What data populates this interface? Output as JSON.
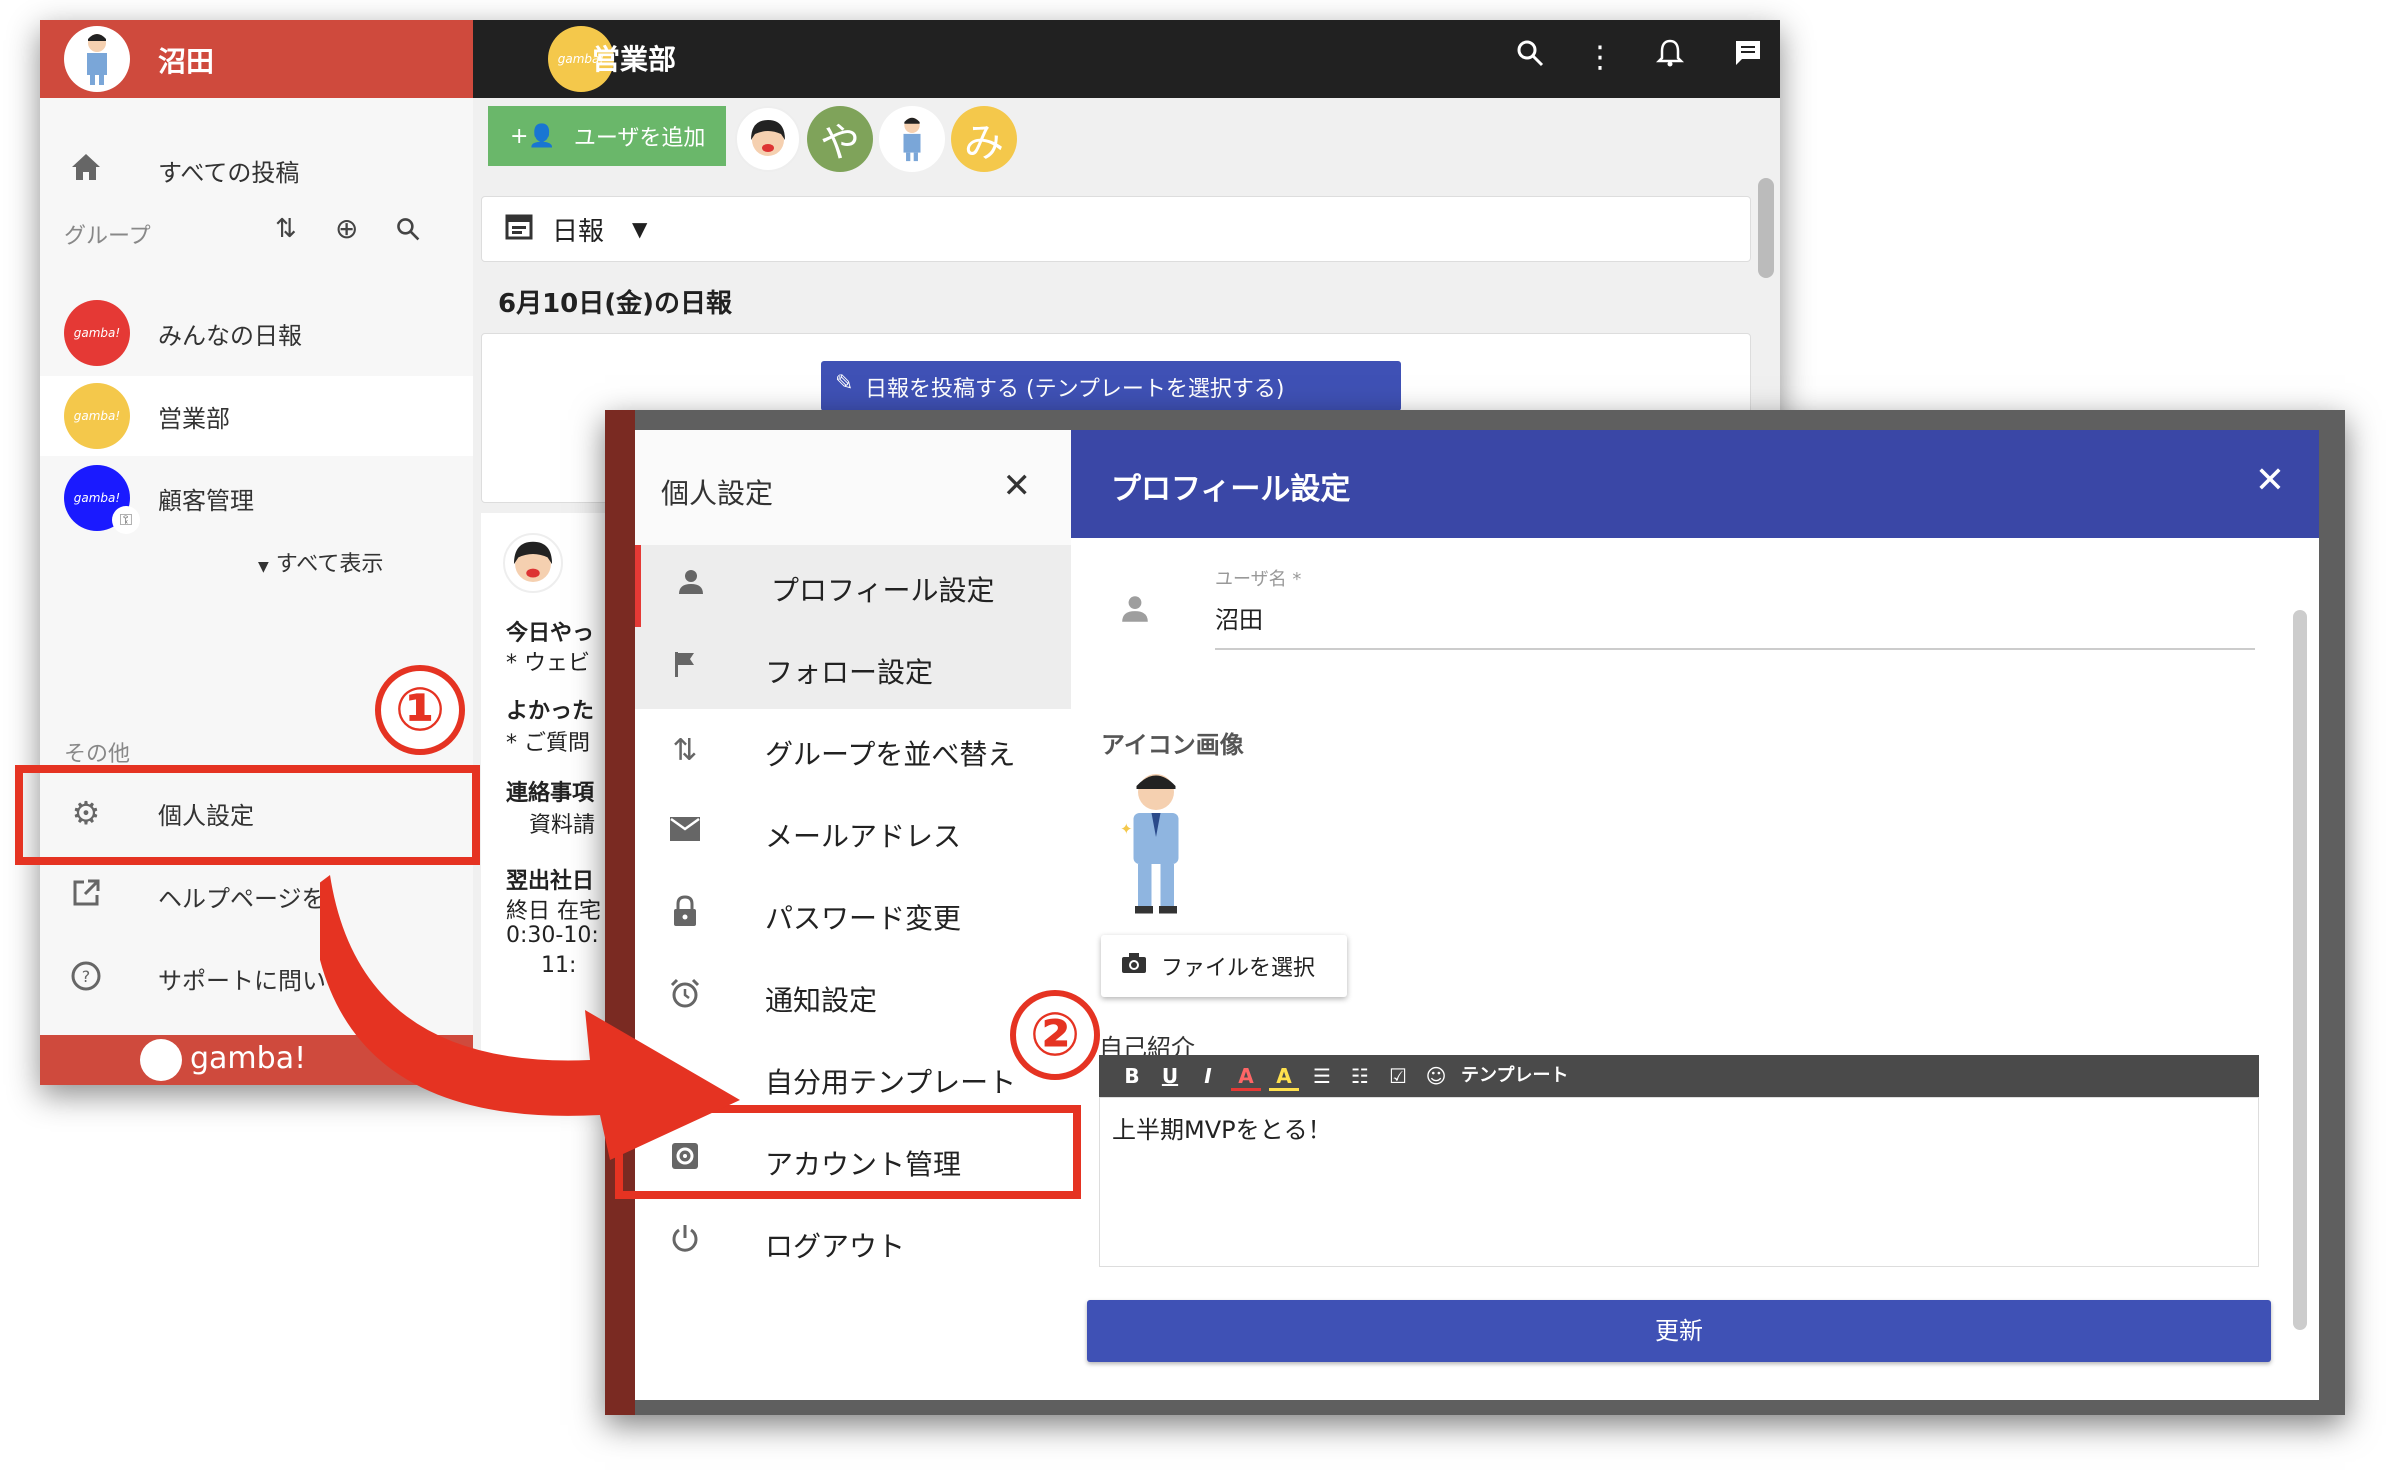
{
  "back_window": {
    "user_name": "沼田",
    "group_name": "営業部",
    "group_avatar_text": "gamba!",
    "sidebar": {
      "all_posts": "すべての投稿",
      "groups_label": "グループ",
      "groups": [
        {
          "name": "みんなの日報",
          "avatar_text": "gamba!",
          "color": "#e53935"
        },
        {
          "name": "営業部",
          "avatar_text": "gamba!",
          "color": "#f4c84b"
        },
        {
          "name": "顧客管理",
          "avatar_text": "gamba!",
          "color": "#1a1aff"
        }
      ],
      "show_all": "すべて表示",
      "other_label": "その他",
      "personal_settings": "個人設定",
      "help_page": "ヘルプページを",
      "support": "サポートに問い",
      "footer_brand": "gamba!"
    },
    "main": {
      "add_user_button": "ユーザを追加",
      "members": [
        {
          "letter": "",
          "color": "#ffffff"
        },
        {
          "letter": "や",
          "color": "#7fa35a"
        },
        {
          "letter": "",
          "color": "#ffffff"
        },
        {
          "letter": "み",
          "color": "#f4c84b"
        }
      ],
      "report_type": "日報",
      "date_heading": "6月10日(金)の日報",
      "post_button": "日報を投稿する (テンプレートを選択する)",
      "feed": [
        "今日やっ",
        "* ウェビ",
        "よかった",
        "* ご質問",
        "連絡事項",
        "資料請",
        "翌出社日",
        "終日 在宅",
        "0:30-10:",
        "11:"
      ]
    }
  },
  "settings_dialog": {
    "title": "個人設定",
    "menu": [
      {
        "label": "プロフィール設定",
        "icon": "person-icon"
      },
      {
        "label": "フォロー設定",
        "icon": "flag-icon"
      },
      {
        "label": "グループを並べ替え",
        "icon": "swap-icon"
      },
      {
        "label": "メールアドレス",
        "icon": "mail-icon"
      },
      {
        "label": "パスワード変更",
        "icon": "lock-icon"
      },
      {
        "label": "通知設定",
        "icon": "alarm-icon"
      },
      {
        "label": "自分用テンプレート",
        "icon": "pencil-icon"
      },
      {
        "label": "アカウント管理",
        "icon": "gear-icon"
      },
      {
        "label": "ログアウト",
        "icon": "power-icon"
      }
    ]
  },
  "profile": {
    "title": "プロフィール設定",
    "username_label": "ユーザ名 *",
    "username_value": "沼田",
    "icon_image_label": "アイコン画像",
    "file_select_button": "ファイルを選択",
    "self_intro_label": "自己紹介",
    "editor_tools": [
      "B",
      "U",
      "I",
      "A",
      "A",
      "☰",
      "☷",
      "☑",
      "☺",
      "テンプレート"
    ],
    "self_intro_text": "上半期MVPをとる！",
    "update_button": "更新"
  },
  "annotations": {
    "step1": "①",
    "step2": "②"
  },
  "colors": {
    "brand_red": "#cf4a3d",
    "indigo": "#3f51b5",
    "highlight": "#e53322"
  }
}
